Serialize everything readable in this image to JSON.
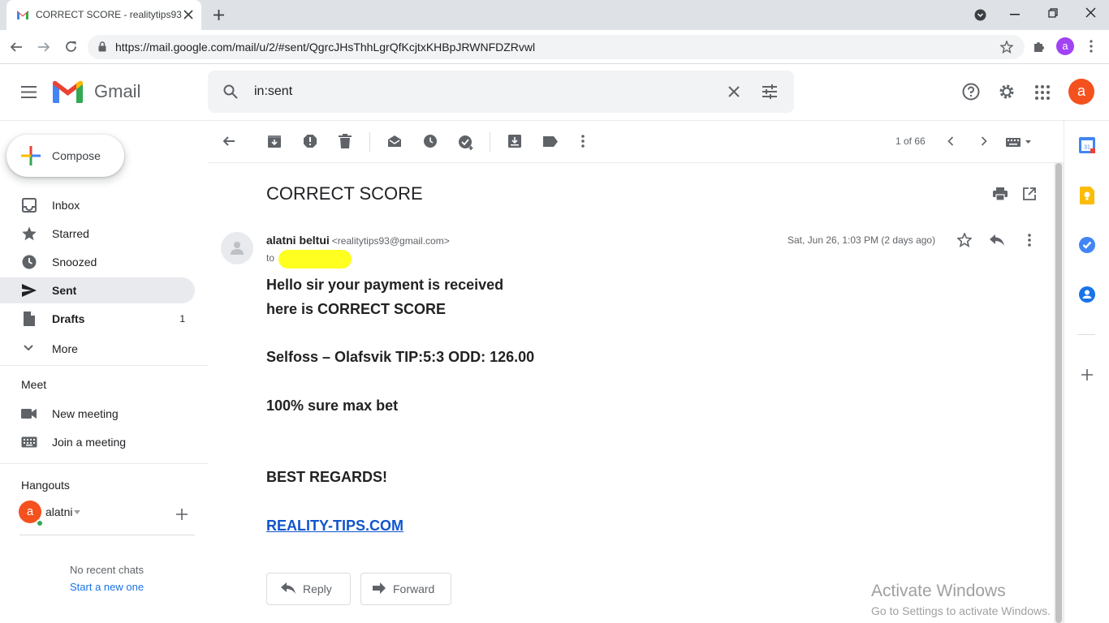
{
  "browser": {
    "tab_title": "CORRECT SCORE - realitytips93@",
    "url": "https://mail.google.com/mail/u/2/#sent/QgrcJHsThhLgrQfKcjtxKHBpJRWNFDZRvwl",
    "profile_initial": "a"
  },
  "gmail": {
    "brand": "Gmail",
    "search_value": "in:sent",
    "account_initial": "a"
  },
  "sidebar": {
    "compose_label": "Compose",
    "items": [
      {
        "label": "Inbox",
        "count": ""
      },
      {
        "label": "Starred",
        "count": ""
      },
      {
        "label": "Snoozed",
        "count": ""
      },
      {
        "label": "Sent",
        "count": ""
      },
      {
        "label": "Drafts",
        "count": "1"
      },
      {
        "label": "More",
        "count": ""
      }
    ],
    "meet_title": "Meet",
    "meet_items": [
      "New meeting",
      "Join a meeting"
    ],
    "hangouts_title": "Hangouts",
    "hangouts_user": "alatni",
    "hangouts_user_initial": "a",
    "no_recent": "No recent chats",
    "start_new": "Start a new one"
  },
  "toolbar": {
    "page_count": "1 of 66"
  },
  "message": {
    "subject": "CORRECT SCORE",
    "sender_name": "alatni beltui",
    "sender_email": "<realitytips93@gmail.com>",
    "to_label": "to",
    "date": "Sat, Jun 26, 1:03 PM (2 days ago)",
    "body_lines": [
      "Hello sir your payment is received",
      "here is CORRECT SCORE",
      "Selfoss – Olafsvik  TIP:5:3  ODD: 126.00",
      "100% sure max bet",
      "BEST REGARDS!"
    ],
    "link_text": "REALITY-TIPS.COM",
    "reply_label": "Reply",
    "forward_label": "Forward"
  },
  "watermark": {
    "line1": "Activate Windows",
    "line2": "Go to Settings to activate Windows."
  },
  "colors": {
    "accent_red": "#ea4335",
    "account_orange": "#f4511e",
    "profile_purple": "#a142f4",
    "link_blue": "#1155cc"
  }
}
